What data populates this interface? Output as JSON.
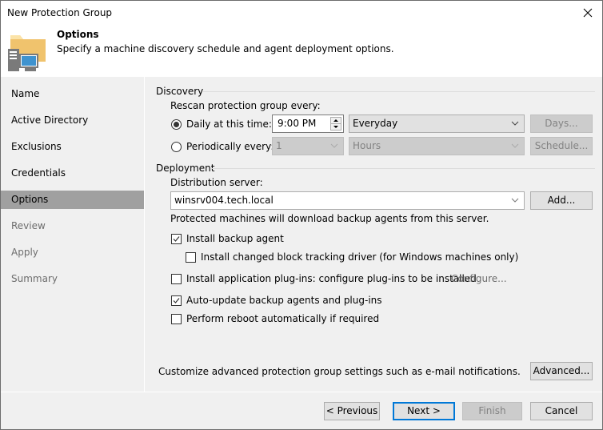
{
  "window": {
    "title": "New Protection Group"
  },
  "header": {
    "title": "Options",
    "subtitle": "Specify a machine discovery schedule and agent deployment options.",
    "icon": "folder-computer-icon"
  },
  "sidebar": {
    "items": [
      {
        "label": "Name",
        "state": "enabled"
      },
      {
        "label": "Active Directory",
        "state": "enabled"
      },
      {
        "label": "Exclusions",
        "state": "enabled"
      },
      {
        "label": "Credentials",
        "state": "enabled"
      },
      {
        "label": "Options",
        "state": "active"
      },
      {
        "label": "Review",
        "state": "disabled"
      },
      {
        "label": "Apply",
        "state": "disabled"
      },
      {
        "label": "Summary",
        "state": "disabled"
      }
    ]
  },
  "discovery": {
    "group_label": "Discovery",
    "rescan_label": "Rescan protection group every:",
    "daily": {
      "label": "Daily at this time:",
      "selected": true,
      "time_value": "9:00 PM",
      "days_option": "Everyday",
      "days_button": "Days..."
    },
    "periodic": {
      "label": "Periodically every:",
      "selected": false,
      "interval_value": "1",
      "unit_value": "Hours",
      "schedule_button": "Schedule..."
    }
  },
  "deployment": {
    "group_label": "Deployment",
    "server_label": "Distribution server:",
    "server_value": "winsrv004.tech.local",
    "add_button": "Add...",
    "server_note": "Protected machines will download backup agents from this server.",
    "options": [
      {
        "label": "Install backup agent",
        "checked": true
      },
      {
        "label": "Install changed block tracking driver (for Windows machines only)",
        "checked": false
      },
      {
        "label": "Install application plug-ins: configure plug-ins to be installed",
        "checked": false,
        "link": "Configure..."
      },
      {
        "label": "Auto-update backup agents and plug-ins",
        "checked": true
      },
      {
        "label": "Perform reboot automatically if required",
        "checked": false
      }
    ]
  },
  "advanced": {
    "note": "Customize advanced protection group settings such as e-mail notifications.",
    "button": "Advanced..."
  },
  "footer": {
    "previous": "< Previous",
    "next": "Next >",
    "finish": "Finish",
    "cancel": "Cancel"
  }
}
